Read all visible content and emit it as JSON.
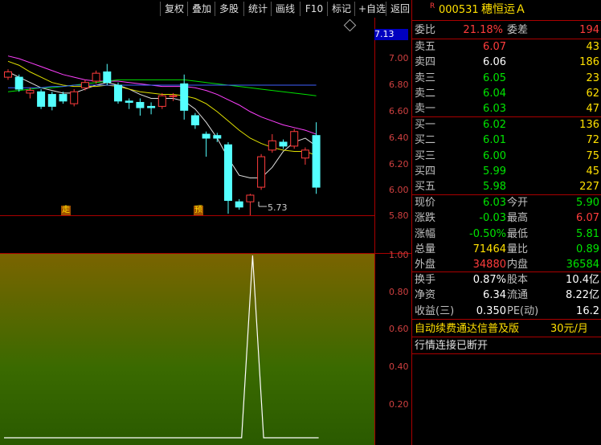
{
  "toolbar": {
    "buttons": [
      "复权",
      "叠加",
      "多股",
      "统计",
      "画线",
      "F10",
      "标记",
      "+自选",
      "返回"
    ]
  },
  "stock": {
    "marker": "R",
    "code": "000531",
    "name": "穗恒运Ａ"
  },
  "price_axis": {
    "current": "7.13",
    "ticks": [
      "7.00",
      "6.80",
      "6.60",
      "6.40",
      "6.20",
      "6.00",
      "5.80"
    ]
  },
  "indicator_axis": {
    "ticks": [
      "1.00",
      "0.80",
      "0.60",
      "0.40",
      "0.20"
    ]
  },
  "kline": {
    "low_label": "5.73",
    "mark_left": "走",
    "mark_right": "预",
    "candles": [
      {
        "o": 6.86,
        "c": 6.9,
        "h": 6.92,
        "l": 6.84
      },
      {
        "o": 6.86,
        "c": 6.77,
        "h": 6.88,
        "l": 6.75
      },
      {
        "o": 6.74,
        "c": 6.76,
        "h": 6.78,
        "l": 6.7
      },
      {
        "o": 6.75,
        "c": 6.64,
        "h": 6.77,
        "l": 6.62
      },
      {
        "o": 6.73,
        "c": 6.64,
        "h": 6.75,
        "l": 6.61
      },
      {
        "o": 6.73,
        "c": 6.68,
        "h": 6.75,
        "l": 6.66
      },
      {
        "o": 6.66,
        "c": 6.75,
        "h": 6.77,
        "l": 6.64
      },
      {
        "o": 6.78,
        "c": 6.82,
        "h": 6.84,
        "l": 6.76
      },
      {
        "o": 6.83,
        "c": 6.89,
        "h": 6.91,
        "l": 6.81
      },
      {
        "o": 6.9,
        "c": 6.82,
        "h": 6.96,
        "l": 6.8
      },
      {
        "o": 6.8,
        "c": 6.68,
        "h": 6.82,
        "l": 6.66
      },
      {
        "o": 6.68,
        "c": 6.67,
        "h": 6.7,
        "l": 6.62
      },
      {
        "o": 6.67,
        "c": 6.63,
        "h": 6.7,
        "l": 6.57
      },
      {
        "o": 6.64,
        "c": 6.63,
        "h": 6.67,
        "l": 6.58
      },
      {
        "o": 6.64,
        "c": 6.72,
        "h": 6.74,
        "l": 6.62
      },
      {
        "o": 6.72,
        "c": 6.72,
        "h": 6.74,
        "l": 6.68
      },
      {
        "o": 6.81,
        "c": 6.61,
        "h": 6.88,
        "l": 6.54
      },
      {
        "o": 6.57,
        "c": 6.5,
        "h": 6.59,
        "l": 6.47
      },
      {
        "o": 6.43,
        "c": 6.4,
        "h": 6.45,
        "l": 6.26
      },
      {
        "o": 6.42,
        "c": 6.4,
        "h": 6.44,
        "l": 6.37
      },
      {
        "o": 6.35,
        "c": 5.93,
        "h": 6.37,
        "l": 5.83
      },
      {
        "o": 5.92,
        "c": 5.88,
        "h": 5.94,
        "l": 5.86
      },
      {
        "o": 5.92,
        "c": 5.97,
        "h": 5.98,
        "l": 5.73
      },
      {
        "o": 6.03,
        "c": 6.26,
        "h": 6.28,
        "l": 6.01
      },
      {
        "o": 6.31,
        "c": 6.38,
        "h": 6.43,
        "l": 6.29
      },
      {
        "o": 6.37,
        "c": 6.34,
        "h": 6.39,
        "l": 6.32
      },
      {
        "o": 6.34,
        "c": 6.45,
        "h": 6.47,
        "l": 6.32
      },
      {
        "o": 6.25,
        "c": 6.31,
        "h": 6.33,
        "l": 6.2
      },
      {
        "o": 6.42,
        "c": 6.03,
        "h": 6.52,
        "l": 5.98
      }
    ],
    "ma_lines": {
      "colors": [
        "#e0e0e0",
        "#e0e000",
        "#ff40ff",
        "#00e000",
        "#4060ff"
      ],
      "series": [
        [
          6.9,
          6.86,
          6.82,
          6.78,
          6.76,
          6.74,
          6.74,
          6.77,
          6.8,
          6.82,
          6.8,
          6.77,
          6.73,
          6.7,
          6.7,
          6.7,
          6.68,
          6.62,
          6.52,
          6.4,
          6.25,
          6.12,
          6.1,
          6.1,
          6.18,
          6.3,
          6.37,
          6.4,
          6.34
        ],
        [
          6.98,
          6.95,
          6.9,
          6.86,
          6.82,
          6.8,
          6.79,
          6.79,
          6.79,
          6.8,
          6.79,
          6.77,
          6.75,
          6.74,
          6.73,
          6.73,
          6.72,
          6.7,
          6.66,
          6.6,
          6.53,
          6.46,
          6.4,
          6.36,
          6.33,
          6.31,
          6.3,
          6.3,
          6.27
        ],
        [
          7.02,
          7.0,
          6.97,
          6.94,
          6.91,
          6.88,
          6.86,
          6.84,
          6.83,
          6.83,
          6.83,
          6.82,
          6.81,
          6.8,
          6.79,
          6.79,
          6.79,
          6.78,
          6.76,
          6.73,
          6.69,
          6.65,
          6.6,
          6.56,
          6.53,
          6.5,
          6.48,
          6.46,
          6.43
        ],
        [
          6.75,
          6.76,
          6.77,
          6.78,
          6.78,
          6.79,
          6.8,
          6.81,
          6.82,
          6.83,
          6.84,
          6.84,
          6.84,
          6.84,
          6.84,
          6.84,
          6.84,
          6.83,
          6.82,
          6.81,
          6.8,
          6.79,
          6.78,
          6.77,
          6.76,
          6.75,
          6.74,
          6.73,
          6.72
        ],
        [
          6.78,
          6.78,
          6.78,
          6.78,
          6.79,
          6.79,
          6.8,
          6.8,
          6.8,
          6.8,
          6.8,
          6.8,
          6.8,
          6.8,
          6.8,
          6.8,
          6.8,
          6.8,
          6.8,
          6.8,
          6.8,
          6.8,
          6.8,
          6.8,
          6.8,
          6.8,
          6.8,
          6.8,
          6.8
        ]
      ]
    }
  },
  "indicator": {
    "values": [
      0,
      0,
      0,
      0,
      0,
      0,
      0,
      0,
      0,
      0,
      0,
      0,
      0,
      0,
      0,
      0,
      0,
      0,
      0,
      0,
      0,
      0,
      1,
      0,
      0,
      0,
      0,
      0,
      0
    ]
  },
  "quote": {
    "weibi_label": "委比",
    "weibi_value": "21.18%",
    "weicha_label": "委差",
    "weicha_value": "194",
    "asks": [
      {
        "label": "卖五",
        "price": "6.07",
        "vol": "43",
        "color": "red"
      },
      {
        "label": "卖四",
        "price": "6.06",
        "vol": "186",
        "color": "white"
      },
      {
        "label": "卖三",
        "price": "6.05",
        "vol": "23",
        "color": "green"
      },
      {
        "label": "卖二",
        "price": "6.04",
        "vol": "62",
        "color": "green"
      },
      {
        "label": "卖一",
        "price": "6.03",
        "vol": "47",
        "color": "green"
      }
    ],
    "bids": [
      {
        "label": "买一",
        "price": "6.02",
        "vol": "136",
        "color": "green"
      },
      {
        "label": "买二",
        "price": "6.01",
        "vol": "72",
        "color": "green"
      },
      {
        "label": "买三",
        "price": "6.00",
        "vol": "75",
        "color": "green"
      },
      {
        "label": "买四",
        "price": "5.99",
        "vol": "45",
        "color": "green"
      },
      {
        "label": "买五",
        "price": "5.98",
        "vol": "227",
        "color": "green"
      }
    ],
    "stats1": [
      {
        "l1": "现价",
        "v1": "6.03",
        "c1": "green",
        "l2": "今开",
        "v2": "5.90",
        "c2": "green"
      },
      {
        "l1": "涨跌",
        "v1": "-0.03",
        "c1": "green",
        "l2": "最高",
        "v2": "6.07",
        "c2": "red"
      },
      {
        "l1": "涨幅",
        "v1": "-0.50%",
        "c1": "green",
        "l2": "最低",
        "v2": "5.81",
        "c2": "green"
      },
      {
        "l1": "总量",
        "v1": "71464",
        "c1": "yellow",
        "l2": "量比",
        "v2": "0.89",
        "c2": "green"
      },
      {
        "l1": "外盘",
        "v1": "34880",
        "c1": "red",
        "l2": "内盘",
        "v2": "36584",
        "c2": "green"
      }
    ],
    "stats2": [
      {
        "l1": "换手",
        "v1": "0.87%",
        "l2": "股本",
        "v2": "10.4亿"
      },
      {
        "l1": "净资",
        "v1": "6.34",
        "l2": "流通",
        "v2": "8.22亿"
      },
      {
        "l1": "收益(三)",
        "v1": "0.350",
        "l2": "PE(动)",
        "v2": "16.2"
      }
    ],
    "ad_text": "自动续费通达信普及版",
    "ad_price": "30元/月",
    "status": "行情连接已断开"
  }
}
